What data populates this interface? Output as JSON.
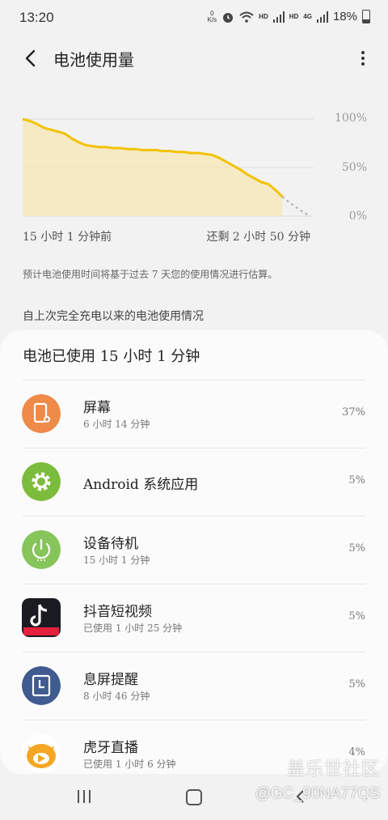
{
  "status": {
    "time": "13:20",
    "net_speed_value": "0",
    "net_speed_unit": "K/s",
    "signal_label_1": "HD",
    "signal_label_2": "HD",
    "lte_label": "4G",
    "battery_text": "18%"
  },
  "header": {
    "title": "电池使用量"
  },
  "chart_data": {
    "type": "line",
    "ylabels": [
      "100%",
      "50%",
      "0%"
    ],
    "ylim": [
      0,
      100
    ],
    "x_start_label": "15 小时 1 分钟前",
    "x_end_label": "还剩 2 小时 50 分钟",
    "series": [
      {
        "values": [
          100,
          98,
          95,
          91,
          89,
          87,
          85,
          80,
          76,
          73,
          72,
          71,
          71,
          70,
          70,
          69,
          69,
          68,
          68,
          68,
          67,
          67,
          66,
          66,
          65,
          65,
          64,
          63,
          60,
          56,
          52,
          48,
          43,
          39,
          35,
          33,
          27,
          20
        ]
      },
      {
        "values": [
          20,
          14,
          9,
          4,
          0
        ]
      }
    ],
    "grid": true
  },
  "note": "预计电池使用时间将基于过去 7 天您的使用情况进行估算。",
  "section_title": "自上次完全充电以来的电池使用情况",
  "card": {
    "title": "电池已使用 15 小时 1 分钟",
    "items": [
      {
        "name": "屏幕",
        "sub": "6 小时 14 分钟",
        "pct": "37%",
        "icon": "screen-icon"
      },
      {
        "name": "Android 系统应用",
        "sub": "",
        "pct": "5%",
        "icon": "gear-icon"
      },
      {
        "name": "设备待机",
        "sub": "15 小时 1 分钟",
        "pct": "5%",
        "icon": "power-icon"
      },
      {
        "name": "抖音短视频",
        "sub": "已使用 1 小时 25 分钟",
        "pct": "5%",
        "icon": "douyin-icon"
      },
      {
        "name": "息屏提醒",
        "sub": "8 小时 46 分钟",
        "pct": "5%",
        "icon": "always-on-display-icon"
      },
      {
        "name": "虎牙直播",
        "sub": "已使用 1 小时 6 分钟",
        "pct": "4%",
        "icon": "huya-icon"
      }
    ]
  },
  "watermark": {
    "brand": "盖乐世社区",
    "user": "@GC_90NA77QS"
  },
  "colors": {
    "accent_line": "#f2c200",
    "fill": "#f7e7b5",
    "screen": "#ef8a48",
    "android": "#7cbc3c",
    "standby": "#86c55a",
    "aod": "#3f5b8f"
  }
}
